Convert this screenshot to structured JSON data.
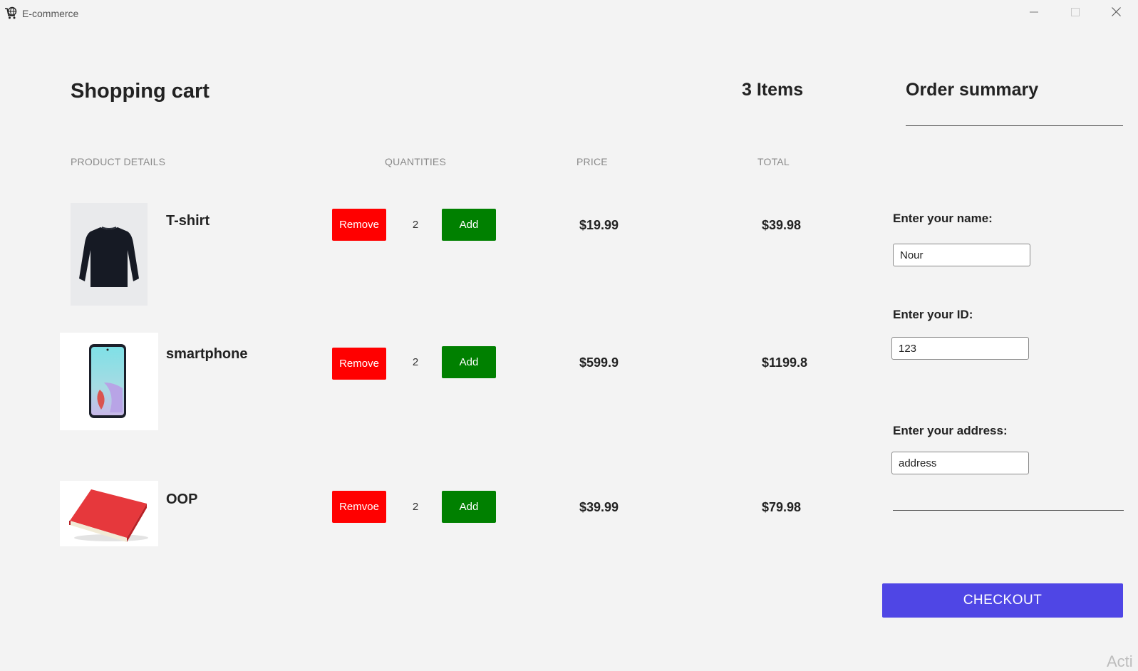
{
  "window": {
    "title": "E-commerce",
    "icon": "shopping-cart-globe-icon",
    "controls": [
      "minimize-icon",
      "maximize-icon",
      "close-icon"
    ]
  },
  "cart": {
    "heading": "Shopping cart",
    "items_count": "3 Items",
    "columns": {
      "product": "PRODUCT DETAILS",
      "quantity": "QUANTITIES",
      "price": "PRICE",
      "total": "TOTAL"
    },
    "items": [
      {
        "name": "T-shirt",
        "image": "long-sleeve-shirt-image",
        "remove_label": "Remove",
        "quantity": "2",
        "add_label": "Add",
        "price": "$19.99",
        "total": "$39.98"
      },
      {
        "name": "smartphone",
        "image": "smartphone-image",
        "remove_label": "Remove",
        "quantity": "2",
        "add_label": "Add",
        "price": "$599.9",
        "total": "$1199.8"
      },
      {
        "name": "OOP",
        "image": "red-book-image",
        "remove_label": "Remvoe",
        "quantity": "2",
        "add_label": "Add",
        "price": "$39.99",
        "total": "$79.98"
      }
    ]
  },
  "summary": {
    "heading": "Order summary",
    "name_label": "Enter your name:",
    "name_value": "Nour",
    "id_label": "Enter your ID:",
    "id_value": "123",
    "address_label": "Enter your address:",
    "address_value": "address",
    "checkout_label": "CHECKOUT"
  },
  "colors": {
    "remove": "#ff0000",
    "add": "#008000",
    "checkout": "#4f46e5",
    "background": "#f3f3f3"
  },
  "watermark": "Acti"
}
